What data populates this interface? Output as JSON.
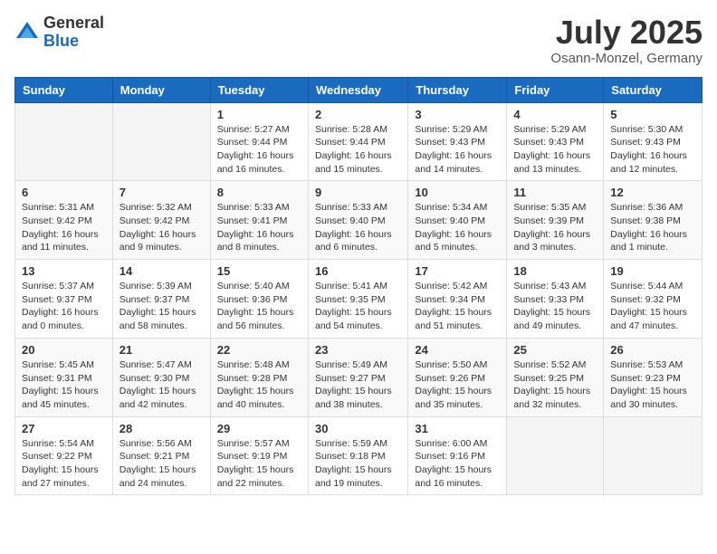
{
  "logo": {
    "general": "General",
    "blue": "Blue"
  },
  "header": {
    "month": "July 2025",
    "location": "Osann-Monzel, Germany"
  },
  "weekdays": [
    "Sunday",
    "Monday",
    "Tuesday",
    "Wednesday",
    "Thursday",
    "Friday",
    "Saturday"
  ],
  "weeks": [
    [
      {
        "day": "",
        "info": ""
      },
      {
        "day": "",
        "info": ""
      },
      {
        "day": "1",
        "info": "Sunrise: 5:27 AM\nSunset: 9:44 PM\nDaylight: 16 hours and 16 minutes."
      },
      {
        "day": "2",
        "info": "Sunrise: 5:28 AM\nSunset: 9:44 PM\nDaylight: 16 hours and 15 minutes."
      },
      {
        "day": "3",
        "info": "Sunrise: 5:29 AM\nSunset: 9:43 PM\nDaylight: 16 hours and 14 minutes."
      },
      {
        "day": "4",
        "info": "Sunrise: 5:29 AM\nSunset: 9:43 PM\nDaylight: 16 hours and 13 minutes."
      },
      {
        "day": "5",
        "info": "Sunrise: 5:30 AM\nSunset: 9:43 PM\nDaylight: 16 hours and 12 minutes."
      }
    ],
    [
      {
        "day": "6",
        "info": "Sunrise: 5:31 AM\nSunset: 9:42 PM\nDaylight: 16 hours and 11 minutes."
      },
      {
        "day": "7",
        "info": "Sunrise: 5:32 AM\nSunset: 9:42 PM\nDaylight: 16 hours and 9 minutes."
      },
      {
        "day": "8",
        "info": "Sunrise: 5:33 AM\nSunset: 9:41 PM\nDaylight: 16 hours and 8 minutes."
      },
      {
        "day": "9",
        "info": "Sunrise: 5:33 AM\nSunset: 9:40 PM\nDaylight: 16 hours and 6 minutes."
      },
      {
        "day": "10",
        "info": "Sunrise: 5:34 AM\nSunset: 9:40 PM\nDaylight: 16 hours and 5 minutes."
      },
      {
        "day": "11",
        "info": "Sunrise: 5:35 AM\nSunset: 9:39 PM\nDaylight: 16 hours and 3 minutes."
      },
      {
        "day": "12",
        "info": "Sunrise: 5:36 AM\nSunset: 9:38 PM\nDaylight: 16 hours and 1 minute."
      }
    ],
    [
      {
        "day": "13",
        "info": "Sunrise: 5:37 AM\nSunset: 9:37 PM\nDaylight: 16 hours and 0 minutes."
      },
      {
        "day": "14",
        "info": "Sunrise: 5:39 AM\nSunset: 9:37 PM\nDaylight: 15 hours and 58 minutes."
      },
      {
        "day": "15",
        "info": "Sunrise: 5:40 AM\nSunset: 9:36 PM\nDaylight: 15 hours and 56 minutes."
      },
      {
        "day": "16",
        "info": "Sunrise: 5:41 AM\nSunset: 9:35 PM\nDaylight: 15 hours and 54 minutes."
      },
      {
        "day": "17",
        "info": "Sunrise: 5:42 AM\nSunset: 9:34 PM\nDaylight: 15 hours and 51 minutes."
      },
      {
        "day": "18",
        "info": "Sunrise: 5:43 AM\nSunset: 9:33 PM\nDaylight: 15 hours and 49 minutes."
      },
      {
        "day": "19",
        "info": "Sunrise: 5:44 AM\nSunset: 9:32 PM\nDaylight: 15 hours and 47 minutes."
      }
    ],
    [
      {
        "day": "20",
        "info": "Sunrise: 5:45 AM\nSunset: 9:31 PM\nDaylight: 15 hours and 45 minutes."
      },
      {
        "day": "21",
        "info": "Sunrise: 5:47 AM\nSunset: 9:30 PM\nDaylight: 15 hours and 42 minutes."
      },
      {
        "day": "22",
        "info": "Sunrise: 5:48 AM\nSunset: 9:28 PM\nDaylight: 15 hours and 40 minutes."
      },
      {
        "day": "23",
        "info": "Sunrise: 5:49 AM\nSunset: 9:27 PM\nDaylight: 15 hours and 38 minutes."
      },
      {
        "day": "24",
        "info": "Sunrise: 5:50 AM\nSunset: 9:26 PM\nDaylight: 15 hours and 35 minutes."
      },
      {
        "day": "25",
        "info": "Sunrise: 5:52 AM\nSunset: 9:25 PM\nDaylight: 15 hours and 32 minutes."
      },
      {
        "day": "26",
        "info": "Sunrise: 5:53 AM\nSunset: 9:23 PM\nDaylight: 15 hours and 30 minutes."
      }
    ],
    [
      {
        "day": "27",
        "info": "Sunrise: 5:54 AM\nSunset: 9:22 PM\nDaylight: 15 hours and 27 minutes."
      },
      {
        "day": "28",
        "info": "Sunrise: 5:56 AM\nSunset: 9:21 PM\nDaylight: 15 hours and 24 minutes."
      },
      {
        "day": "29",
        "info": "Sunrise: 5:57 AM\nSunset: 9:19 PM\nDaylight: 15 hours and 22 minutes."
      },
      {
        "day": "30",
        "info": "Sunrise: 5:59 AM\nSunset: 9:18 PM\nDaylight: 15 hours and 19 minutes."
      },
      {
        "day": "31",
        "info": "Sunrise: 6:00 AM\nSunset: 9:16 PM\nDaylight: 15 hours and 16 minutes."
      },
      {
        "day": "",
        "info": ""
      },
      {
        "day": "",
        "info": ""
      }
    ]
  ]
}
